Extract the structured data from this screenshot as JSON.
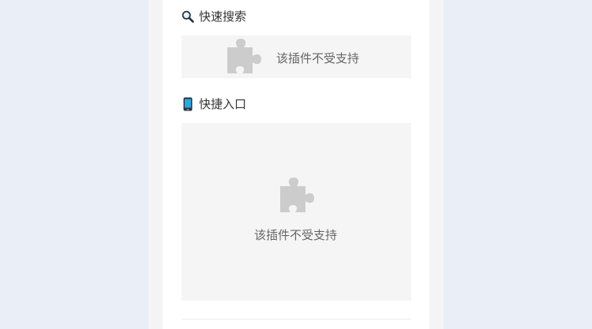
{
  "sections": [
    {
      "emoji_icon": "magnifier-icon",
      "title": "快速搜索",
      "plugin_message": "该插件不受支持"
    },
    {
      "emoji_icon": "mobile-phone-icon",
      "title": "快捷入口",
      "plugin_message": "该插件不受支持"
    }
  ],
  "colors": {
    "background": "#e9eef7",
    "card": "#ffffff",
    "plugin_placeholder": "#f5f5f5",
    "puzzle_icon": "#cccccc",
    "text": "#333333",
    "plugin_text": "#666666"
  }
}
